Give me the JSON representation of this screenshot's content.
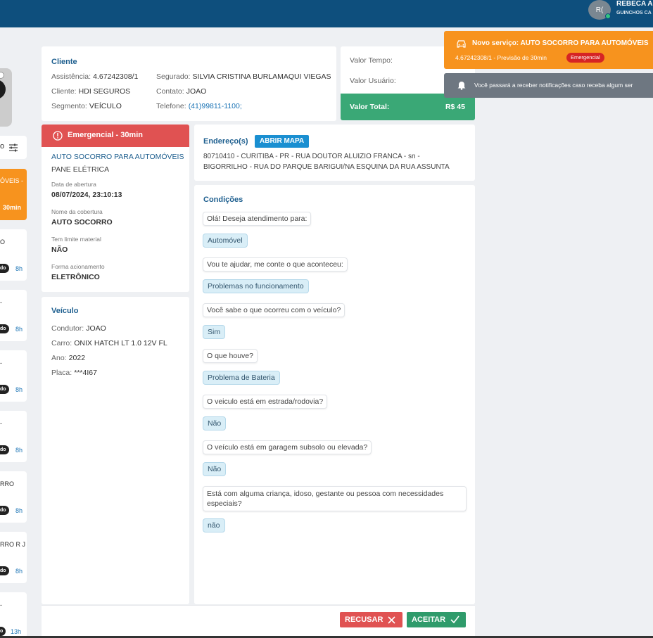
{
  "header": {
    "avatar_initials": "R(",
    "user_name": "REBECA AN",
    "user_company": "GUINCHOS CA"
  },
  "left_list": {
    "filter_label": "o",
    "items": [
      {
        "title": "ÓVEIS -",
        "time": "30min",
        "active": true
      },
      {
        "title": "O",
        "badge": "do",
        "time": "8h"
      },
      {
        "title": "-",
        "badge": "do",
        "time": "8h"
      },
      {
        "title": "-",
        "badge": "do",
        "time": "8h"
      },
      {
        "title": "-",
        "badge": "do",
        "time": "8h"
      },
      {
        "title": "RRO",
        "badge": "do",
        "time": "8h"
      },
      {
        "title": "RRO R J",
        "badge": "do",
        "time": "8h"
      },
      {
        "title": "-",
        "badge": "o",
        "time": "13h"
      }
    ]
  },
  "cliente": {
    "title": "Cliente",
    "assistencia_label": "Assistência:",
    "assistencia": "4.67242308/1",
    "cliente_label": "Cliente:",
    "cliente": "HDI SEGUROS",
    "segmento_label": "Segmento:",
    "segmento": "VEÍCULO",
    "segurado_label": "Segurado:",
    "segurado": "SILVIA CRISTINA BURLAMAQUI VIEGAS",
    "contato_label": "Contato:",
    "contato": "JOAO",
    "telefone_label": "Telefone:",
    "telefone": "(41)99811-1100;"
  },
  "valores": {
    "tempo_label": "Valor Tempo:",
    "usuario_label": "Valor Usuário:",
    "total_label": "Valor Total:",
    "total": "R$ 45"
  },
  "servico": {
    "header": "Emergencial - 30min",
    "service_name": "AUTO SOCORRO PARA AUTOMÓVEIS",
    "problem": "PANE ELÉTRICA",
    "abertura_label": "Data de abertura",
    "abertura": "08/07/2024, 23:10:13",
    "cobertura_label": "Nome da cobertura",
    "cobertura": "AUTO SOCORRO",
    "limite_label": "Tem limite material",
    "limite": "NÃO",
    "acionamento_label": "Forma acionamento",
    "acionamento": "ELETRÔNICO"
  },
  "veiculo": {
    "title": "Veículo",
    "condutor_label": "Condutor:",
    "condutor": "JOAO",
    "carro_label": "Carro:",
    "carro": "ONIX HATCH LT 1.0 12V FL",
    "ano_label": "Ano:",
    "ano": "2022",
    "placa_label": "Placa:",
    "placa": "***4I67"
  },
  "endereco": {
    "title": "Endereço(s)",
    "map_button": "ABRIR MAPA",
    "address": "80710410 - CURITIBA - PR - RUA DOUTOR ALUIZIO FRANCA - sn - BIGORRILHO - RUA DO PARQUE BARIGUI/NA ESQUINA DA RUA ASSUNTA"
  },
  "condicoes": {
    "title": "Condições",
    "messages": [
      {
        "q": "Olá! Deseja atendimento para:",
        "a": "Automóvel"
      },
      {
        "q": "Vou te ajudar, me conte o que aconteceu:",
        "a": "Problemas no funcionamento"
      },
      {
        "q": "Você sabe o que ocorreu com o veículo?",
        "a": "Sim"
      },
      {
        "q": "O que houve?",
        "a": "Problema de Bateria"
      },
      {
        "q": "O veiculo está em estrada/rodovia?",
        "a": "Não"
      },
      {
        "q": "O veículo está em garagem subsolo ou elevada?",
        "a": "Não"
      },
      {
        "q": "Está com alguma criança, idoso, gestante ou pessoa com necessidades especiais?",
        "a": "não"
      }
    ]
  },
  "actions": {
    "recusar": "RECUSAR",
    "aceitar": "ACEITAR"
  },
  "toasts": {
    "new_service_title": "Novo serviço: AUTO SOCORRO PARA AUTOMÓVEIS",
    "new_service_sub": "4.67242308/1 - Previsão de 30min",
    "new_service_badge": "Emergencial",
    "notify_text": "Você passará a receber notificações caso receba algum ser"
  },
  "colors": {
    "header": "#0e4f7d",
    "emergency": "#e05252",
    "total": "#3aa876",
    "toast_orange": "#f7931e",
    "accept": "#2f9b6b",
    "reject": "#e05252"
  }
}
